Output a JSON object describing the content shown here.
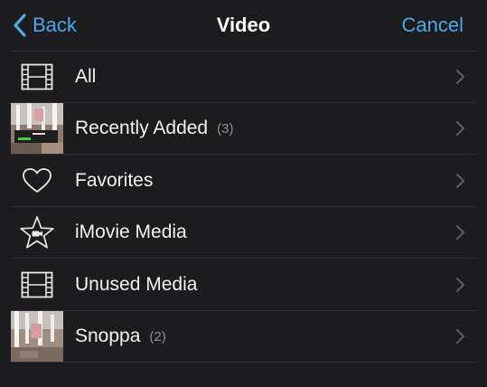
{
  "nav": {
    "back_label": "Back",
    "title": "Video",
    "cancel_label": "Cancel",
    "accent_color": "#4aa8e8"
  },
  "rows": [
    {
      "label": "All",
      "count": "",
      "icon": "film-strip-icon"
    },
    {
      "label": "Recently Added",
      "count": "(3)",
      "icon": "video-thumbnail"
    },
    {
      "label": "Favorites",
      "count": "",
      "icon": "heart-icon"
    },
    {
      "label": "iMovie Media",
      "count": "",
      "icon": "star-camera-icon"
    },
    {
      "label": "Unused Media",
      "count": "",
      "icon": "film-strip-icon"
    },
    {
      "label": "Snoppa",
      "count": "(2)",
      "icon": "video-thumbnail"
    }
  ]
}
